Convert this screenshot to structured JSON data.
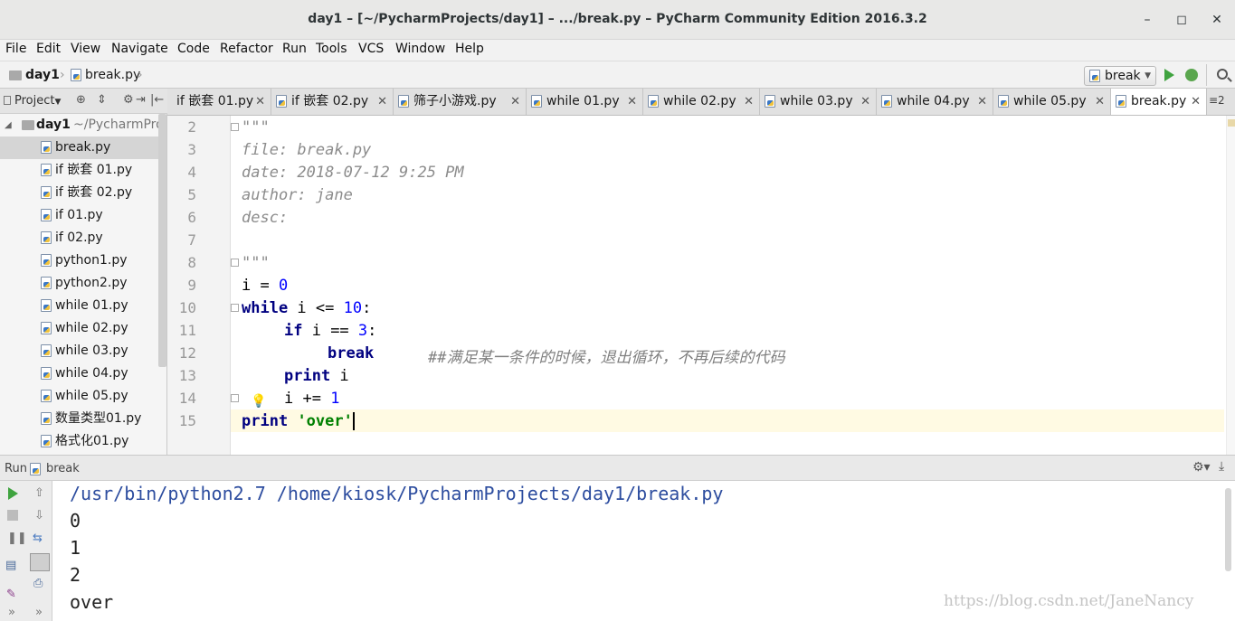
{
  "window": {
    "title": "day1 – [~/PycharmProjects/day1] – .../break.py – PyCharm Community Edition 2016.3.2",
    "minimize": "–",
    "maximize": "◻",
    "close": "✕"
  },
  "menu": [
    "File",
    "Edit",
    "View",
    "Navigate",
    "Code",
    "Refactor",
    "Run",
    "Tools",
    "VCS",
    "Window",
    "Help"
  ],
  "breadcrumb": {
    "project": "day1",
    "file": "break.py"
  },
  "run_config": {
    "name": "break"
  },
  "project_panel": {
    "label": "Project",
    "root": {
      "name": "day1",
      "path": "~/PycharmProje"
    },
    "files": [
      "break.py",
      "if 嵌套 01.py",
      "if 嵌套 02.py",
      "if 01.py",
      "if 02.py",
      "python1.py",
      "python2.py",
      "while 01.py",
      "while 02.py",
      "while 03.py",
      "while 04.py",
      "while 05.py",
      "数量类型01.py",
      "格式化01.py"
    ],
    "selected_index": 0
  },
  "tabs": [
    {
      "label": "if 嵌套 01.py",
      "active": false
    },
    {
      "label": "if 嵌套 02.py",
      "active": false
    },
    {
      "label": "筛子小游戏.py",
      "active": false
    },
    {
      "label": "while 01.py",
      "active": false
    },
    {
      "label": "while 02.py",
      "active": false
    },
    {
      "label": "while 03.py",
      "active": false
    },
    {
      "label": "while 04.py",
      "active": false
    },
    {
      "label": "while 05.py",
      "active": false
    },
    {
      "label": "break.py",
      "active": true
    }
  ],
  "tabs_overflow": "≡2",
  "editor": {
    "line_numbers": [
      "2",
      "3",
      "4",
      "5",
      "6",
      "7",
      "8",
      "9",
      "10",
      "11",
      "12",
      "13",
      "14",
      "15"
    ],
    "doc_quote": "\"\"\"",
    "doc_file": "file: break.py",
    "doc_date": "date: 2018-07-12 9:25 PM",
    "doc_author": "author: jane",
    "doc_desc": "desc:",
    "l9": {
      "var": "i",
      "op": " = ",
      "num": "0"
    },
    "l10": {
      "kw": "while",
      "rest": " i <= ",
      "num": "10",
      "tail": ":"
    },
    "l11": {
      "kw": "if",
      "rest": " i == ",
      "num": "3",
      "tail": ":"
    },
    "l12": {
      "kw": "break",
      "comment": "##满足某一条件的时候，退出循环，不再后续的代码"
    },
    "l13": {
      "kw": "print",
      "rest": " i"
    },
    "l14": {
      "text": "i += ",
      "num": "1"
    },
    "l15": {
      "kw": "print",
      "str": "'over'"
    }
  },
  "run_panel": {
    "label": "Run",
    "config": "break",
    "output": [
      "/usr/bin/python2.7 /home/kiosk/PycharmProjects/day1/break.py",
      "0",
      "1",
      "2",
      "over"
    ]
  },
  "watermark": "https://blog.csdn.net/JaneNancy"
}
